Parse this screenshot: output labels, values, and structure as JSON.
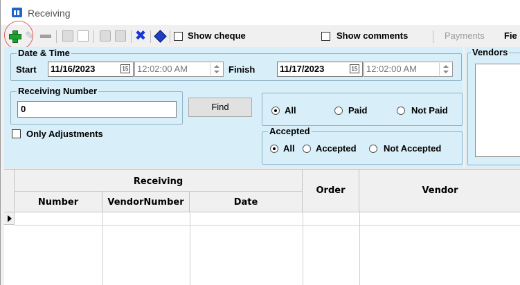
{
  "window": {
    "title": "Receiving"
  },
  "toolbar": {
    "show_cheque": "Show cheque",
    "show_comments": "Show comments",
    "payments": "Payments",
    "fie": "Fie"
  },
  "date_time": {
    "legend": "Date & Time",
    "start_label": "Start",
    "start_date": "11/16/2023",
    "start_time": "12:02:00 AM",
    "finish_label": "Finish",
    "finish_date": "11/17/2023",
    "finish_time": "12:02:00 AM",
    "calendar_glyph": "15"
  },
  "receiving_number": {
    "legend": "Receiving Number",
    "value": "0",
    "find_label": "Find"
  },
  "only_adjustments": "Only Adjustments",
  "paid_filter": {
    "options": [
      "All",
      "Paid",
      "Not Paid"
    ],
    "selected": "All"
  },
  "accepted": {
    "legend": "Accepted",
    "options": [
      "All",
      "Accepted",
      "Not Accepted"
    ],
    "selected": "All"
  },
  "vendors": {
    "legend": "Vendors"
  },
  "grid": {
    "group_header": "Receiving",
    "columns": [
      "Number",
      "VendorNumber",
      "Date",
      "Order",
      "Vendor"
    ]
  },
  "colors": {
    "panel": "#d8eef8",
    "add_icon": "#20a030",
    "highlight_circle": "#e06060",
    "action_blue": "#1838d8"
  }
}
